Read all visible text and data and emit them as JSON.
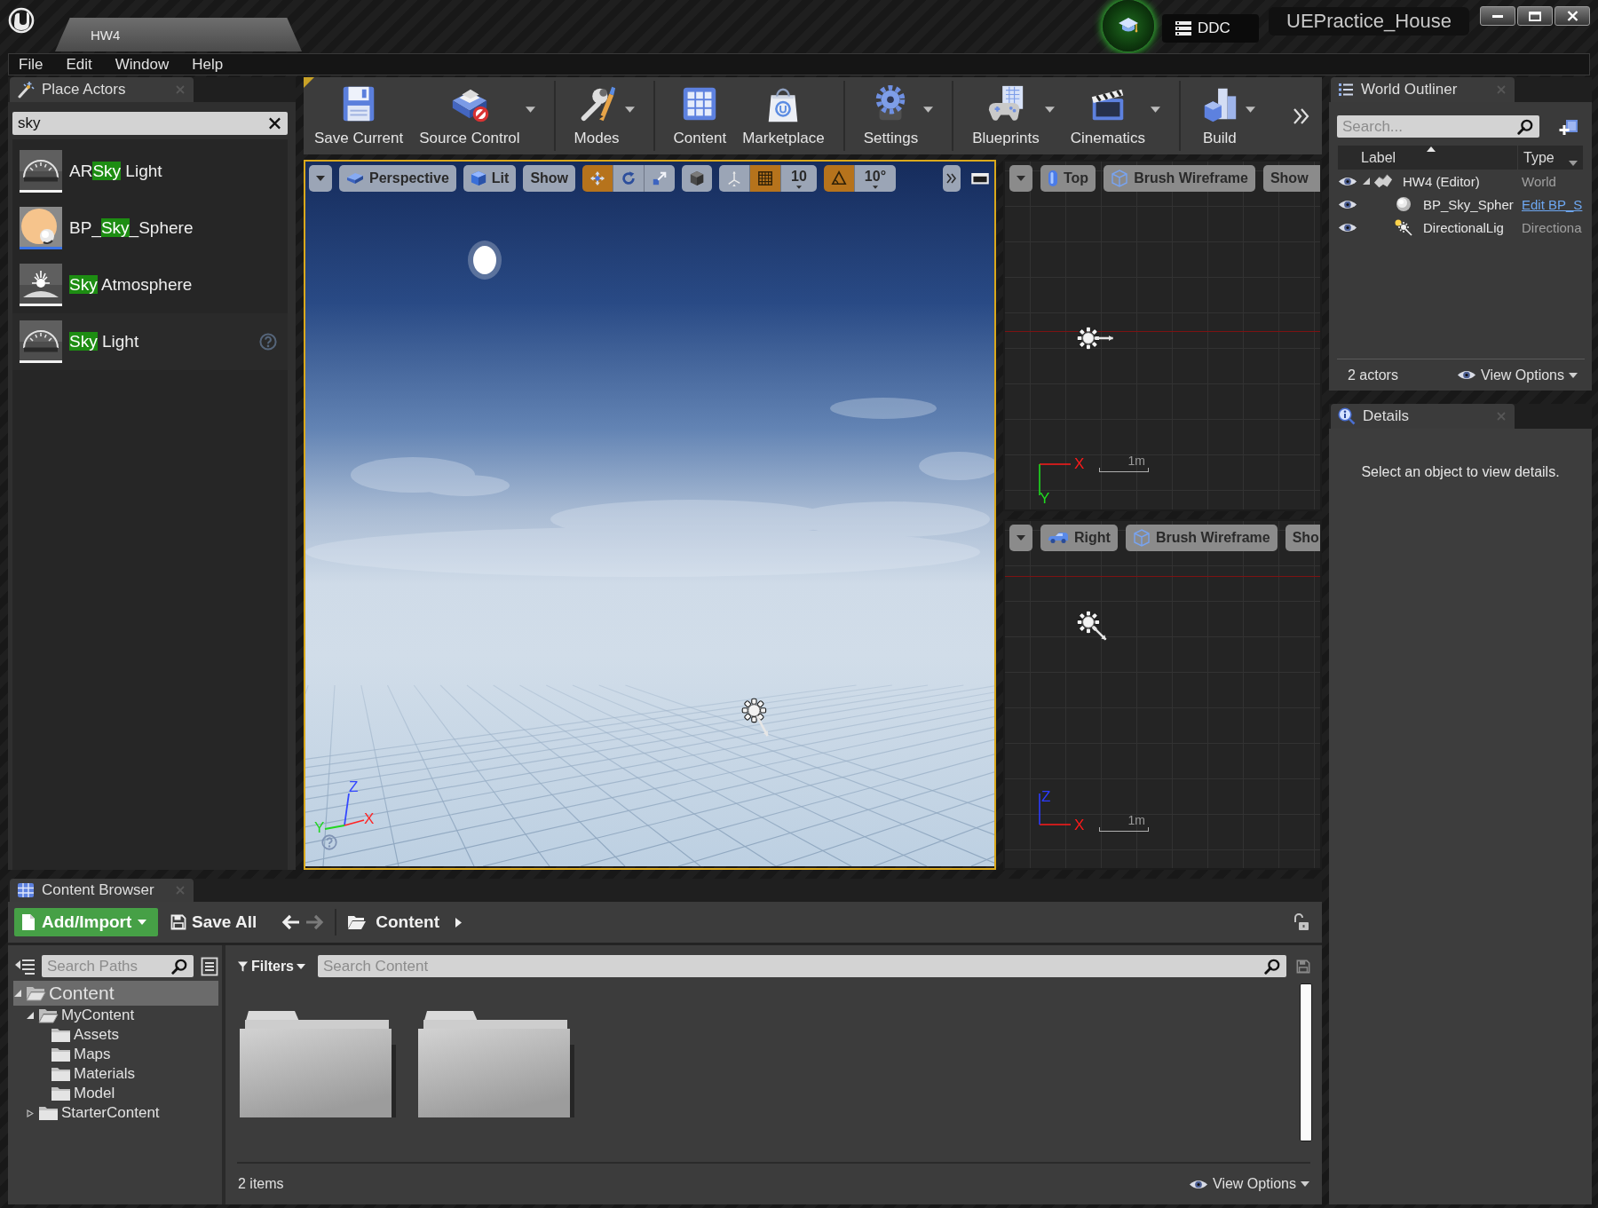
{
  "title_bar": {
    "tab": "HW4",
    "ddc": "DDC",
    "project": "UEPractice_House"
  },
  "menu": [
    {
      "label": "File"
    },
    {
      "label": "Edit"
    },
    {
      "label": "Window"
    },
    {
      "label": "Help"
    }
  ],
  "place_actors": {
    "title": "Place Actors",
    "search": {
      "value": "sky"
    },
    "items": [
      {
        "kind": "light",
        "before": "AR",
        "match": "Sky",
        "after": " Light",
        "hovered": false
      },
      {
        "kind": "blueprint",
        "before": "BP_",
        "match": "Sky",
        "after": "_Sphere",
        "hovered": false
      },
      {
        "kind": "atmosphere",
        "match": "Sky",
        "after": " Atmosphere",
        "hovered": false
      },
      {
        "kind": "light",
        "match": "Sky",
        "after": " Light",
        "hovered": true
      }
    ]
  },
  "toolbar": {
    "groups": [
      [
        {
          "kind": "save",
          "label": "Save Current",
          "dropdown": false
        },
        {
          "kind": "source",
          "label": "Source Control",
          "dropdown": true
        }
      ],
      [
        {
          "kind": "modes",
          "label": "Modes",
          "dropdown": true
        }
      ],
      [
        {
          "kind": "content",
          "label": "Content",
          "dropdown": false
        },
        {
          "kind": "marketplace",
          "label": "Marketplace",
          "dropdown": false
        }
      ],
      [
        {
          "kind": "settings",
          "label": "Settings",
          "dropdown": true
        }
      ],
      [
        {
          "kind": "blueprints",
          "label": "Blueprints",
          "dropdown": true
        },
        {
          "kind": "cinematics",
          "label": "Cinematics",
          "dropdown": true
        }
      ],
      [
        {
          "kind": "build",
          "label": "Build",
          "dropdown": true
        }
      ]
    ]
  },
  "perspective_viewport": {
    "active": true,
    "view": "Perspective",
    "lighting": "Lit",
    "show": "Show",
    "transform_tools": [
      {
        "kind": "move",
        "selected": true
      },
      {
        "kind": "rotate",
        "selected": false
      },
      {
        "kind": "scale",
        "selected": false
      }
    ],
    "grid_snap": {
      "on": true,
      "value": "10"
    },
    "rotation_snap": {
      "on": true,
      "value": "10°"
    },
    "axes": [
      {
        "label": "Z",
        "color": "#3347ff"
      },
      {
        "label": "Y",
        "color": "#22d622"
      },
      {
        "label": "X",
        "color": "#ff2424"
      }
    ]
  },
  "ortho_viewports": [
    {
      "kind": "top",
      "active": false,
      "view": "Top",
      "mode": "Brush Wireframe",
      "show": "Show",
      "horizontal_axis": {
        "label": "X",
        "color": "#ff1a1a"
      },
      "vertical_axis": {
        "label": "Y",
        "color": "#1fdc1f"
      },
      "scale": "1m"
    },
    {
      "kind": "side",
      "active": false,
      "view": "Right",
      "mode": "Brush Wireframe",
      "show": "Sho",
      "horizontal_axis": {
        "label": "X",
        "color": "#ff1a1a"
      },
      "vertical_axis": {
        "label": "Z",
        "color": "#2b3bff"
      },
      "scale": "1m"
    }
  ],
  "world_outliner": {
    "title": "World Outliner",
    "search": {
      "placeholder": "Search..."
    },
    "columns": [
      {
        "label": "Label",
        "sorted": true,
        "menu": false
      },
      {
        "label": "Type",
        "sorted": false,
        "menu": true
      }
    ],
    "rows": [
      {
        "kind": "world",
        "label": "HW4 (Editor)",
        "type": "World",
        "link": false,
        "visible": true,
        "expanded": true,
        "children": [
          {
            "kind": "sphere",
            "label": "BP_Sky_Spher",
            "type": "Edit BP_S",
            "link": true,
            "visible": true
          },
          {
            "kind": "light",
            "label": "DirectionalLig",
            "type": "Directiona",
            "link": false,
            "visible": true
          }
        ]
      }
    ],
    "count": "2 actors",
    "view_options": "View Options"
  },
  "details": {
    "title": "Details",
    "message": "Select an object to view details."
  },
  "content_browser": {
    "title": "Content Browser",
    "add_button": "Add/Import",
    "save_all": "Save All",
    "back": {
      "disabled": false
    },
    "forward": {
      "disabled": true
    },
    "path": [
      {
        "label": "Content"
      }
    ],
    "locked": false,
    "paths_search": {
      "placeholder": "Search Paths"
    },
    "tree": [
      {
        "label": "Content",
        "selected": true,
        "expanded": true,
        "children": [
          {
            "label": "MyContent",
            "selected": false,
            "expanded": true,
            "children": [
              {
                "label": "Assets",
                "selected": false
              },
              {
                "label": "Maps",
                "selected": false
              },
              {
                "label": "Materials",
                "selected": false
              },
              {
                "label": "Model",
                "selected": false
              }
            ]
          },
          {
            "label": "StarterContent",
            "selected": false,
            "expanded": false
          }
        ]
      }
    ],
    "filters": "Filters",
    "content_search": {
      "placeholder": "Search Content"
    },
    "assets": [
      {
        "kind": "folder"
      },
      {
        "kind": "folder"
      }
    ],
    "count": "2 items",
    "view_options": "View Options"
  }
}
